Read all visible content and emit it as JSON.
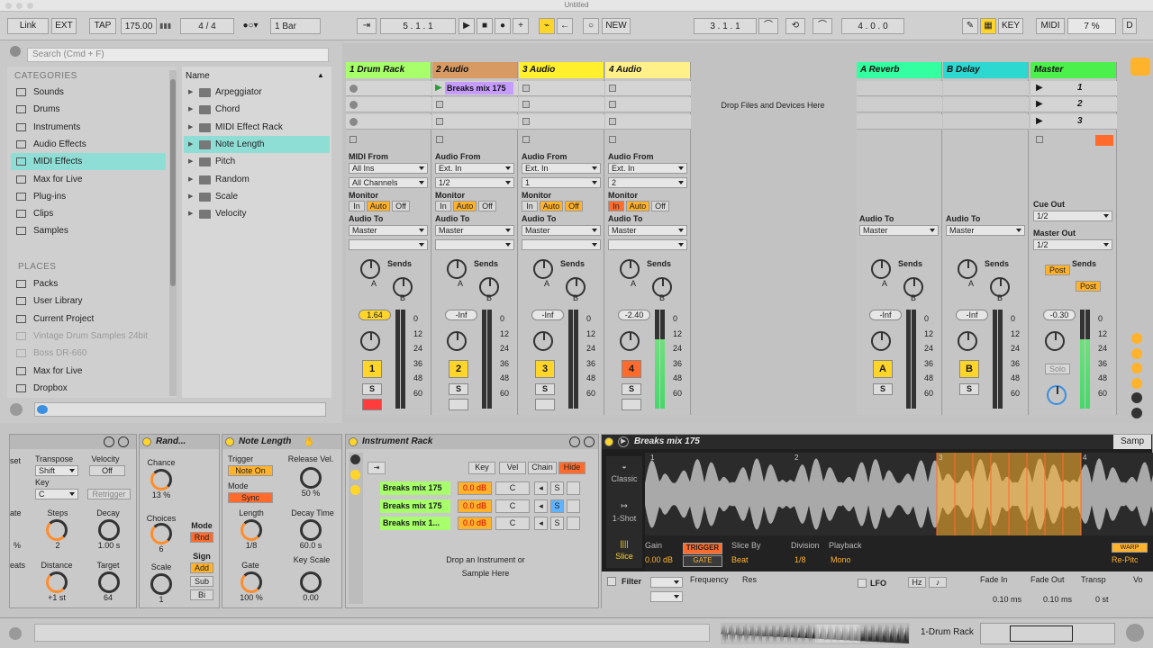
{
  "window": {
    "title": "Untitled"
  },
  "transport": {
    "link": "Link",
    "ext": "EXT",
    "tap": "TAP",
    "tempo": "175.00",
    "time_sig_num": "4",
    "time_sig_sep": "/",
    "time_sig_den": "4",
    "quantize": "1 Bar",
    "arrangement_position": "5 .   1 .   1",
    "new_label": "NEW",
    "loop_start": "3 .   1 .   1",
    "loop_length": "4 .   0 .   0",
    "key_label": "KEY",
    "midi_label": "MIDI",
    "cpu": "7 %",
    "drive": "D"
  },
  "browser": {
    "search_placeholder": "Search (Cmd + F)",
    "categories_heading": "CATEGORIES",
    "categories": [
      {
        "label": "Sounds"
      },
      {
        "label": "Drums"
      },
      {
        "label": "Instruments"
      },
      {
        "label": "Audio Effects"
      },
      {
        "label": "MIDI Effects"
      },
      {
        "label": "Max for Live"
      },
      {
        "label": "Plug-ins"
      },
      {
        "label": "Clips"
      },
      {
        "label": "Samples"
      }
    ],
    "places_heading": "PLACES",
    "places": [
      {
        "label": "Packs"
      },
      {
        "label": "User Library"
      },
      {
        "label": "Current Project"
      },
      {
        "label": "Vintage Drum Samples 24bit"
      },
      {
        "label": "Boss DR-660"
      },
      {
        "label": "Max for Live"
      },
      {
        "label": "Dropbox"
      }
    ],
    "name_header": "Name",
    "items": [
      {
        "label": "Arpeggiator"
      },
      {
        "label": "Chord"
      },
      {
        "label": "MIDI Effect Rack"
      },
      {
        "label": "Note Length"
      },
      {
        "label": "Pitch"
      },
      {
        "label": "Random"
      },
      {
        "label": "Scale"
      },
      {
        "label": "Velocity"
      }
    ]
  },
  "tracks": [
    {
      "name": "1 Drum Rack",
      "color": "#a6ff6b",
      "from_label": "MIDI From",
      "from": "All Ins",
      "channel": "All Channels",
      "to": "Master",
      "vol": "1.64",
      "num": "1"
    },
    {
      "name": "2 Audio",
      "color": "#d79a62",
      "from_label": "Audio From",
      "from": "Ext. In",
      "channel": "1/2",
      "to": "Master",
      "vol": "-Inf",
      "num": "2"
    },
    {
      "name": "3 Audio",
      "color": "#ffef2c",
      "from_label": "Audio From",
      "from": "Ext. In",
      "channel": "1",
      "to": "Master",
      "vol": "-Inf",
      "num": "3"
    },
    {
      "name": "4 Audio",
      "color": "#fff08a",
      "from_label": "Audio From",
      "from": "Ext. In",
      "channel": "2",
      "to": "Master",
      "vol": "-2.40",
      "num": "4"
    }
  ],
  "returns": [
    {
      "name": "A Reverb",
      "color": "#33ffa0",
      "to": "Master",
      "vol": "-Inf",
      "num": "A"
    },
    {
      "name": "B Delay",
      "color": "#2cd8d0",
      "to": "Master",
      "vol": "-Inf",
      "num": "B"
    }
  ],
  "master": {
    "name": "Master",
    "color": "#4cf04c",
    "scenes": [
      "1",
      "2",
      "3"
    ],
    "cue_out_label": "Cue Out",
    "cue_out": "1/2",
    "master_out_label": "Master Out",
    "master_out": "1/2",
    "vol": "-0.30",
    "solo": "Solo",
    "post": "Post"
  },
  "session": {
    "clip_name": "Breaks mix 175",
    "drop_text": "Drop Files and Devices Here",
    "monitor_label": "Monitor",
    "audio_to_label": "Audio To",
    "mon_in": "In",
    "mon_auto": "Auto",
    "mon_off": "Off",
    "sends_label": "Sends",
    "send_a": "A",
    "send_b": "B",
    "scale_ticks": [
      "0",
      "12",
      "24",
      "36",
      "48",
      "60"
    ],
    "s_label": "S"
  },
  "devices": {
    "arp": {
      "transpose_label": "Transpose",
      "transpose": "Shift",
      "velocity_label": "Velocity",
      "velocity": "Off",
      "key_label": "Key",
      "key": "C",
      "retrigger": "Retrigger",
      "steps_label": "Steps",
      "steps": "2",
      "decay_label": "Decay",
      "decay": "1.00 s",
      "distance_label": "Distance",
      "distance": "+1 st",
      "target_label": "Target",
      "target": "64",
      "frag1": "set",
      "frag2": "ate",
      "frag3": "%",
      "frag4": "eats"
    },
    "random": {
      "title": "Rand...",
      "chance_label": "Chance",
      "chance": "13 %",
      "choices_label": "Choices",
      "choices": "6",
      "scale_label": "Scale",
      "scale": "1",
      "mode_label": "Mode",
      "mode": "Rnd",
      "sign_label": "Sign",
      "add": "Add",
      "sub": "Sub",
      "bi": "Bi"
    },
    "note_length": {
      "title": "Note Length",
      "trigger_label": "Trigger",
      "trigger": "Note On",
      "release_label": "Release Vel.",
      "release": "50 %",
      "mode_label": "Mode",
      "mode": "Sync",
      "length_label": "Length",
      "length": "1/8",
      "decay_label": "Decay Time",
      "decay": "60.0 s",
      "gate_label": "Gate",
      "gate": "100 %",
      "keyscale_label": "Key Scale",
      "keyscale": "0.00"
    },
    "rack": {
      "title": "Instrument Rack",
      "key": "Key",
      "vel": "Vel",
      "chain": "Chain",
      "hide": "Hide",
      "chains": [
        {
          "name": "Breaks mix 175",
          "vol": "0.0 dB",
          "pan": "C"
        },
        {
          "name": "Breaks mix 175",
          "vol": "0.0 dB",
          "pan": "C"
        },
        {
          "name": "Breaks mix 1...",
          "vol": "0.0 dB",
          "pan": "C"
        }
      ],
      "drop_text1": "Drop an Instrument or",
      "drop_text2": "Sample Here"
    },
    "simpler": {
      "title": "Breaks mix 175",
      "samp": "Samp",
      "classic": "Classic",
      "one_shot": "1-Shot",
      "slice": "Slice",
      "gain_label": "Gain",
      "gain": "0.00 dB",
      "trigger": "TRIGGER",
      "gate": "GATE",
      "slice_by_label": "Slice By",
      "slice_by": "Beat",
      "division_label": "Division",
      "division": "1/8",
      "playback_label": "Playback",
      "playback": "Mono",
      "warp": "WARP",
      "repitch": "Re-Pitc",
      "filter": "Filter",
      "frequency": "Frequency",
      "res": "Res",
      "lfo": "LFO",
      "hz": "Hz",
      "fade_in_label": "Fade In",
      "fade_in": "0.10 ms",
      "fade_out_label": "Fade Out",
      "fade_out": "0.10 ms",
      "transp_label": "Transp",
      "transp": "0 st",
      "vo": "Vo",
      "markers": [
        "1",
        "2",
        "3",
        "4"
      ]
    }
  },
  "status": {
    "track": "1-Drum Rack"
  }
}
